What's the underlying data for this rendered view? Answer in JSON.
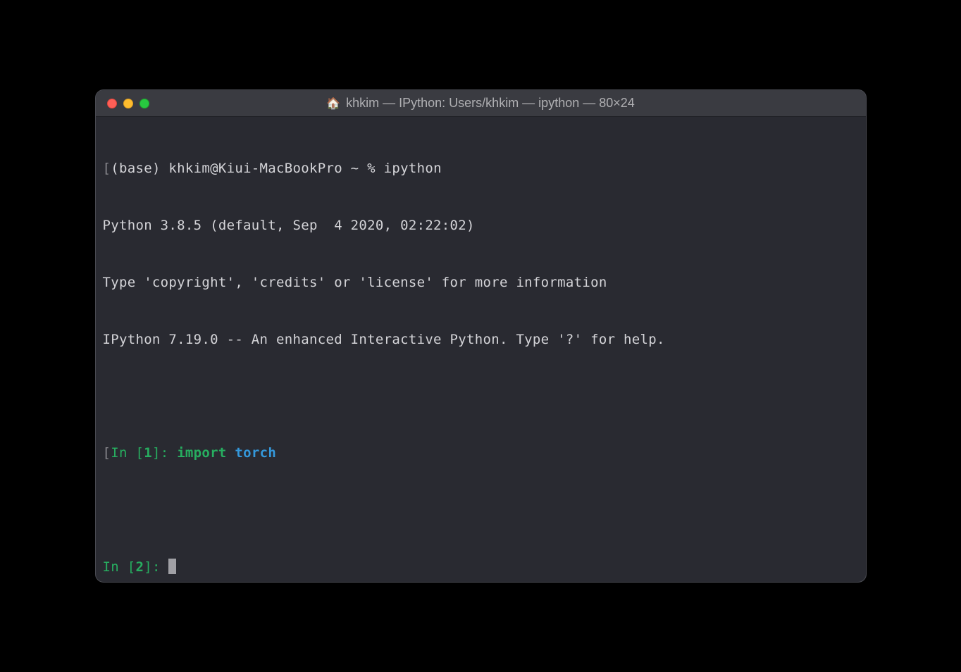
{
  "titlebar": {
    "title": "khkim — IPython: Users/khkim — ipython — 80×24",
    "home_icon": "🏠"
  },
  "terminal": {
    "shell_line": "(base) khkim@Kiui-MacBookPro ~ % ipython",
    "python_version": "Python 3.8.5 (default, Sep  4 2020, 02:22:02)",
    "info_line": "Type 'copyright', 'credits' or 'license' for more information",
    "ipython_line": "IPython 7.19.0 -- An enhanced Interactive Python. Type '?' for help.",
    "in1": {
      "prefix": "In [",
      "num": "1",
      "suffix": "]: ",
      "keyword": "import",
      "module": "torch"
    },
    "in2": {
      "prefix": "In [",
      "num": "2",
      "suffix": "]: "
    },
    "left_bracket": "[",
    "right_bracket": "]"
  }
}
